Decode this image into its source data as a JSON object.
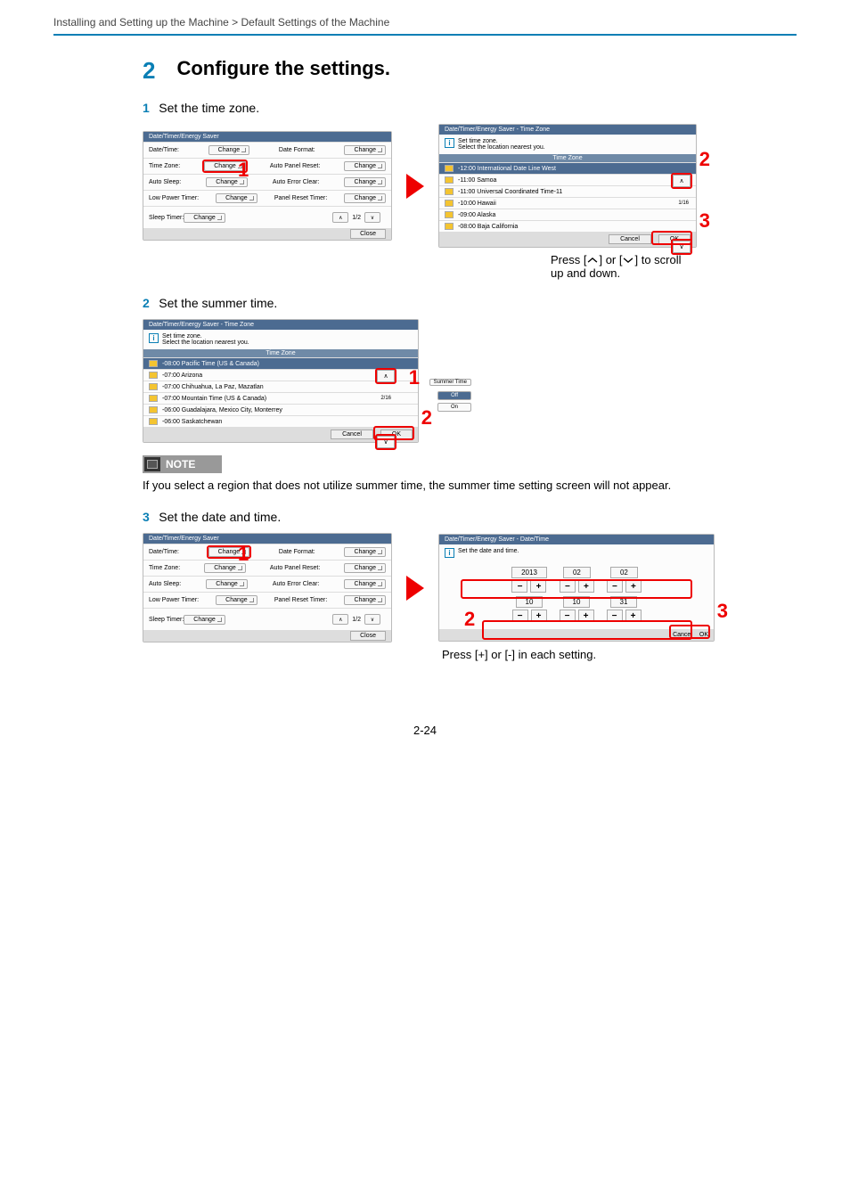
{
  "breadcrumb": "Installing and Setting up the Machine > Default Settings of the Machine",
  "step": {
    "number": "2",
    "title": "Configure the settings."
  },
  "sub1": {
    "num": "1",
    "text": "Set the time zone."
  },
  "sub2": {
    "num": "2",
    "text": "Set the summer time."
  },
  "sub3": {
    "num": "3",
    "text": "Set the date and time."
  },
  "panelA": {
    "title": "Date/Timer/Energy Saver",
    "btn": "Change",
    "rows": [
      {
        "l": "Date/Time:",
        "r": "Date Format:"
      },
      {
        "l": "Time Zone:",
        "r": "Auto Panel Reset:"
      },
      {
        "l": "Auto Sleep:",
        "r": "Auto Error Clear:"
      },
      {
        "l": "Low Power Timer:",
        "r": "Panel Reset Timer:"
      },
      {
        "l": "Sleep Timer:",
        "r": ""
      }
    ],
    "pager": "1/2",
    "close": "Close"
  },
  "panelB": {
    "title": "Date/Timer/Energy Saver - Time Zone",
    "info1": "Set time zone.",
    "info2": "Select the location nearest you.",
    "listhead": "Time Zone",
    "rows": [
      "-12:00 International Date Line West",
      "-11:00 Samoa",
      "-11:00 Universal Coordinated Time-11",
      "-10:00 Hawaii",
      "-09:00 Alaska",
      "-08:00 Baja California"
    ],
    "page": "1/16",
    "cancel": "Cancel",
    "ok": "OK"
  },
  "panelC": {
    "title": "Date/Timer/Energy Saver - Time Zone",
    "info1": "Set time zone.",
    "info2": "Select the location nearest you.",
    "listhead": "Time Zone",
    "rows": [
      "-08:00 Pacific Time (US & Canada)",
      "-07:00 Arizona",
      "-07:00 Chihuahua, La Paz, Mazatlan",
      "-07:00 Mountain Time (US & Canada)",
      "-06:00 Guadalajara, Mexico City, Monterrey",
      "-06:00 Saskatchewan"
    ],
    "page": "2/16",
    "st_label": "Summer Time",
    "off": "Off",
    "on": "On",
    "cancel": "Cancel",
    "ok": "OK"
  },
  "panelD": {
    "title": "Date/Timer/Energy Saver - Date/Time",
    "info": "Set the date and time.",
    "year": "2013",
    "month": "02",
    "day": "02",
    "hour": "10",
    "minute": "10",
    "second": "31",
    "cancel": "Cancel",
    "ok": "OK"
  },
  "hint": {
    "prefix": "Press [",
    "mid": "] or [",
    "suffix": "] to scroll up and down."
  },
  "note": {
    "label": "NOTE",
    "body": "If you select a region that does not utilize summer time, the summer time setting screen will not appear."
  },
  "hint3": "Press [+] or [-] in each setting.",
  "pagenum": "2-24",
  "marks": {
    "one": "1",
    "two": "2",
    "three": "3"
  }
}
